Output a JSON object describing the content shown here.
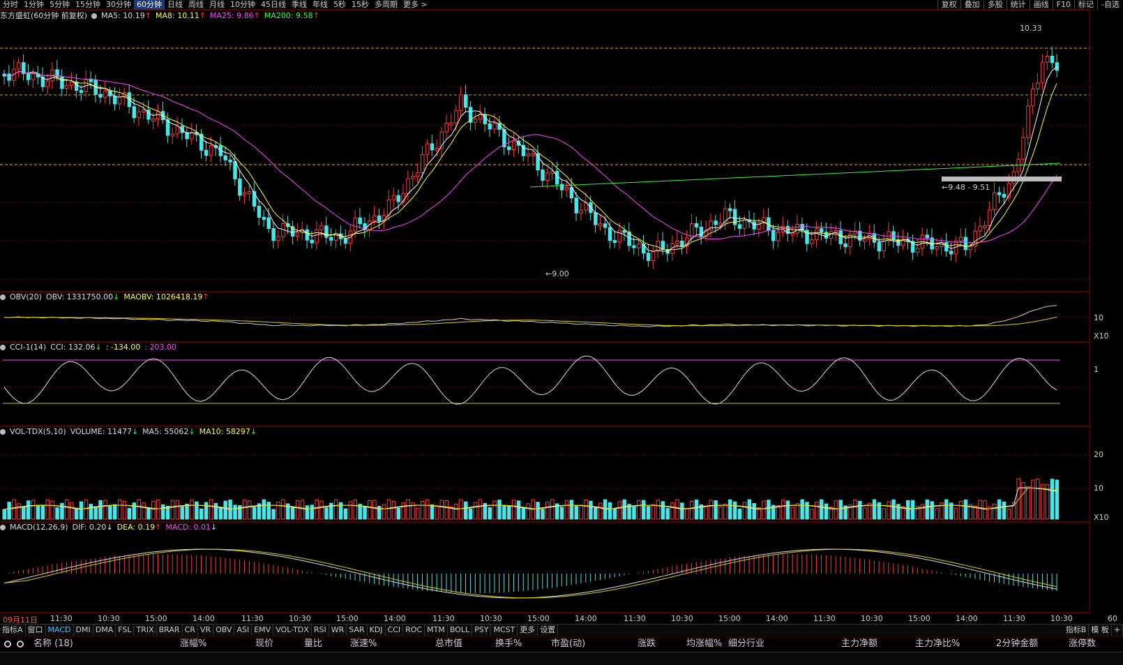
{
  "toolbar": {
    "periods": [
      "分时",
      "1分钟",
      "5分钟",
      "15分钟",
      "30分钟",
      "60分钟",
      "日线",
      "周线",
      "月线",
      "10分钟",
      "45日线",
      "季线",
      "年线",
      "5秒",
      "15秒",
      "多周期",
      "更多 >"
    ],
    "active_period": "60分钟",
    "right_tools": [
      "复权",
      "叠加",
      "多股",
      "统计",
      "画线",
      "F10",
      "标记",
      "-自选"
    ]
  },
  "main_panel": {
    "stock_name": "东方盛虹",
    "period_label": "(60分钟 前复权)",
    "ma5": "MA5: 10.19",
    "ma8": "MA8: 10.11",
    "ma25": "MA25: 9.86",
    "ma200": "MA200: 9.58",
    "up_arrow": "↑",
    "high_label": "10.33",
    "low_label": "9.00",
    "range_label": "9.48 - 9.51"
  },
  "obv_panel": {
    "name": "OBV(20)",
    "obv": "OBV: 1331750.00",
    "obv_arrow": "↓",
    "maobv": "MAOBV: 1026418.19",
    "maobv_arrow": "↑",
    "axis_unit": "X10",
    "axis_val": "10"
  },
  "cci_panel": {
    "name": "CCI-1(14)",
    "cci": "CCI: 132.06",
    "cci_arrow": "↓",
    "low": ": -134.00",
    "high": ": 203.00",
    "axis_val": "1"
  },
  "vol_panel": {
    "name": "VOL-TDX(5,10)",
    "volume": "VOLUME: 11477",
    "vol_arrow": "↓",
    "ma5": "MA5: 55062",
    "ma5_arrow": "↓",
    "ma10": "MA10: 58297",
    "ma10_arrow": "↓",
    "axis_top": "20",
    "axis_mid": "10",
    "axis_unit": "X10"
  },
  "macd_panel": {
    "name": "MACD(12,26,9)",
    "dif": "DIF: 0.20",
    "dif_arrow": "↓",
    "dea": "DEA: 0.19",
    "dea_arrow": "↑",
    "macd": "MACD: 0.01",
    "macd_arrow": "↓"
  },
  "time_axis": [
    "09月11日",
    "11:30",
    "10:30",
    "15:00",
    "14:00",
    "11:30",
    "10:30",
    "15:00",
    "14:00",
    "11:30",
    "10:30",
    "15:00",
    "14:00",
    "11:30",
    "10:30",
    "15:00",
    "14:00",
    "11:30",
    "10:30",
    "15:00",
    "14:00",
    "11:30",
    "10:30"
  ],
  "time_axis_right": "60",
  "indicator_tabs": [
    "指标A",
    "窗口",
    "MACD",
    "DMI",
    "DMA",
    "FSL",
    "TRIX",
    "BRAR",
    "CR",
    "VR",
    "OBV",
    "ASI",
    "EMV",
    "VOL-TDX",
    "RSI",
    "WR",
    "SAR",
    "KDJ",
    "CCI",
    "ROC",
    "MTM",
    "BOLL",
    "PSY",
    "MCST",
    "更多",
    "设置"
  ],
  "active_tab": "MACD",
  "indicator_tabs_right": [
    "指标B",
    "模 板",
    "+"
  ],
  "column_headers": [
    "名称 (18)",
    "涨幅%",
    "现价",
    "量比",
    "涨速%",
    "总市值",
    "换手%",
    "市盈(动)",
    "涨跌",
    "均涨幅%",
    "细分行业",
    "主力净额",
    "主力净比%",
    "2分钟金额",
    "涨停数"
  ],
  "colors": {
    "up": "#ff3b3b",
    "down": "#48e6e6",
    "ma5": "#ffffff",
    "ma8": "#ffff33",
    "ma25": "#ff44ff",
    "ma200": "#33ff33",
    "grid": "#7a0000"
  }
}
